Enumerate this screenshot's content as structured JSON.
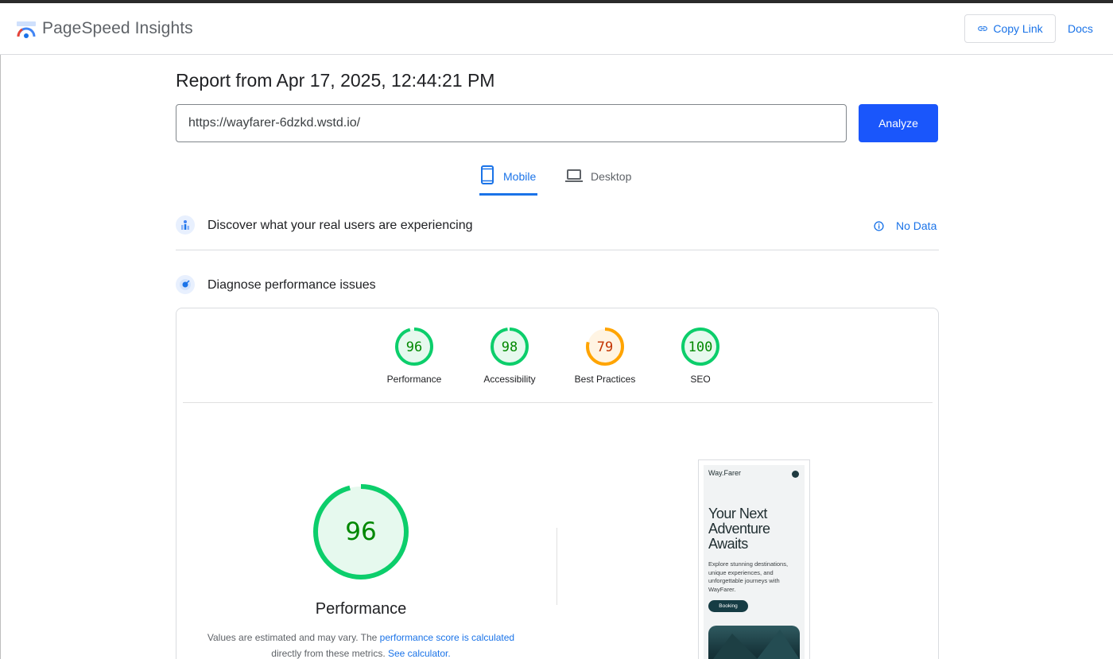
{
  "header": {
    "brand": "PageSpeed Insights",
    "copy_link": "Copy Link",
    "docs": "Docs"
  },
  "report": {
    "title": "Report from Apr 17, 2025, 12:44:21 PM",
    "url": "https://wayfarer-6dzkd.wstd.io/",
    "analyze": "Analyze"
  },
  "tabs": [
    {
      "label": "Mobile",
      "icon": "phone-icon",
      "active": true
    },
    {
      "label": "Desktop",
      "icon": "laptop-icon",
      "active": false
    }
  ],
  "real_users": {
    "title": "Discover what your real users are experiencing",
    "status": "No Data"
  },
  "diagnose": {
    "title": "Diagnose performance issues",
    "scores": [
      {
        "label": "Performance",
        "value": "96",
        "color": "#0cce6b"
      },
      {
        "label": "Accessibility",
        "value": "98",
        "color": "#0cce6b"
      },
      {
        "label": "Best Practices",
        "value": "79",
        "color": "#ffa400"
      },
      {
        "label": "SEO",
        "value": "100",
        "color": "#0cce6b"
      }
    ],
    "main_score": {
      "value": "96",
      "label": "Performance"
    },
    "note": {
      "text1": "Values are estimated and may vary. The ",
      "link1": "performance score is calculated",
      "text2": " directly from these metrics. ",
      "link2": "See calculator."
    }
  },
  "preview": {
    "logo": "Way.Farer",
    "heading": "Your Next Adventure Awaits",
    "body": "Explore stunning destinations, unique experiences, and unforgettable journeys with WayFarer.",
    "button": "Booking"
  }
}
